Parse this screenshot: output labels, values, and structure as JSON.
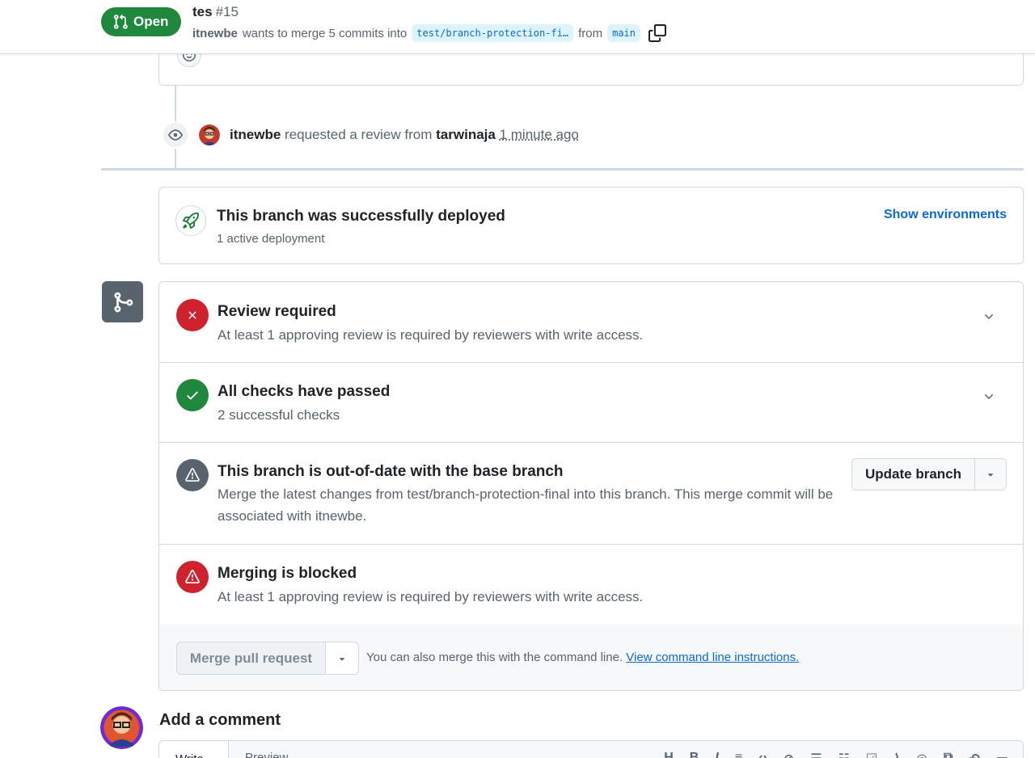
{
  "header": {
    "state": "Open",
    "title": "tes",
    "number": "#15",
    "author": "itnewbe",
    "merge_text": "wants to merge 5 commits into",
    "base_branch": "test/branch-protection-fi…",
    "from_text": "from",
    "head_branch": "main"
  },
  "timeline": {
    "review_event": {
      "actor": "itnewbe",
      "action": "requested a review from",
      "reviewer": "tarwinaja",
      "time": "1 minute ago"
    }
  },
  "deployment": {
    "title": "This branch was successfully deployed",
    "subtitle": "1 active deployment",
    "link": "Show environments"
  },
  "merge": {
    "review": {
      "title": "Review required",
      "desc": "At least 1 approving review is required by reviewers with write access."
    },
    "checks": {
      "title": "All checks have passed",
      "desc": "2 successful checks"
    },
    "outdated": {
      "title": "This branch is out-of-date with the base branch",
      "desc": "Merge the latest changes from test/branch-protection-final into this branch. This merge commit will be associated with itnewbe.",
      "button": "Update branch"
    },
    "blocked": {
      "title": "Merging is blocked",
      "desc": "At least 1 approving review is required by reviewers with write access."
    },
    "footer": {
      "button": "Merge pull request",
      "cli_text": "You can also merge this with the command line.",
      "cli_link": "View command line instructions."
    }
  },
  "comment": {
    "title": "Add a comment",
    "tab_write": "Write",
    "tab_preview": "Preview"
  },
  "colors": {
    "open_green": "#1f883d",
    "danger_red": "#cf222e",
    "neutral_gray": "#59636e",
    "link_blue": "#0969da"
  }
}
